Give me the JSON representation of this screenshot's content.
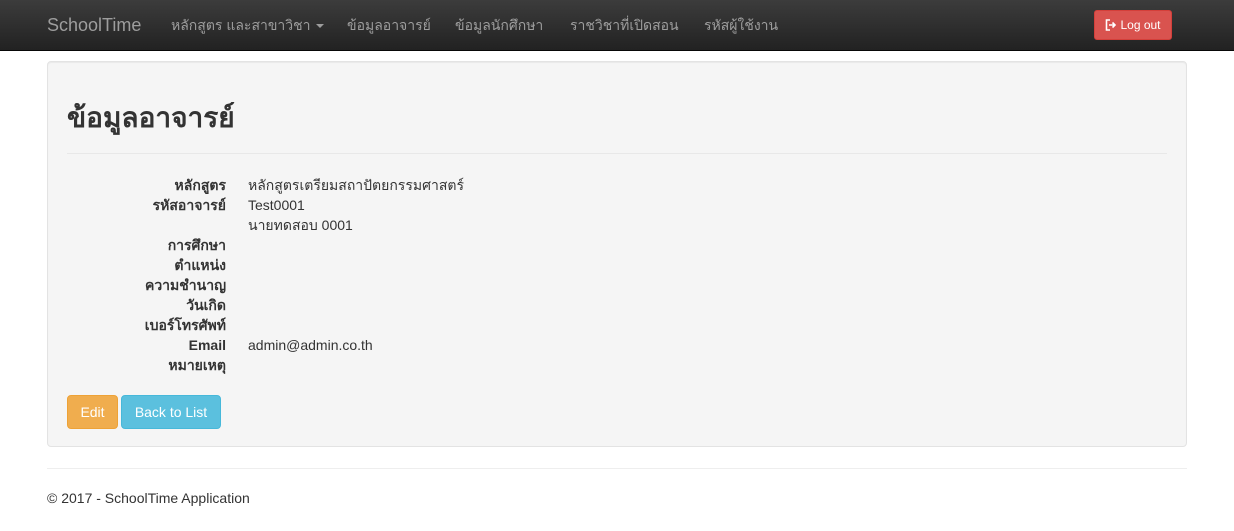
{
  "navbar": {
    "brand": "SchoolTime",
    "items": [
      {
        "label": "หลักสูตร และสาขาวิชา",
        "dropdown": true
      },
      {
        "label": "ข้อมูลอาจารย์"
      },
      {
        "label": "ข้อมูลนักศึกษา"
      },
      {
        "label": "ราชวิชาที่เปิดสอน"
      },
      {
        "label": "รหัสผู้ใช้งาน"
      }
    ],
    "logout_label": "Log out"
  },
  "page": {
    "title": "ข้อมูลอาจารย์",
    "fields": [
      {
        "label": "หลักสูตร",
        "value": "หลักสูตรเตรียมสถาปัตยกรรมศาสตร์"
      },
      {
        "label": "รหัสอาจารย์",
        "value": "Test0001"
      },
      {
        "label": "",
        "value": "นายทดสอบ 0001"
      },
      {
        "label": "การศึกษา",
        "value": ""
      },
      {
        "label": "ตำแหน่ง",
        "value": ""
      },
      {
        "label": "ความชำนาญ",
        "value": ""
      },
      {
        "label": "วันเกิด",
        "value": ""
      },
      {
        "label": "เบอร์โทรศัพท์",
        "value": ""
      },
      {
        "label": "Email",
        "value": "admin@admin.co.th"
      },
      {
        "label": "หมายเหตุ",
        "value": ""
      }
    ],
    "edit_label": "Edit",
    "back_label": "Back to List"
  },
  "footer": {
    "text": "© 2017 - SchoolTime Application"
  },
  "colors": {
    "navbar": "#222222",
    "logout": "#d9534f",
    "edit": "#f0ad4e",
    "back": "#5bc0de"
  },
  "icons": {
    "logout": "logout-icon"
  }
}
